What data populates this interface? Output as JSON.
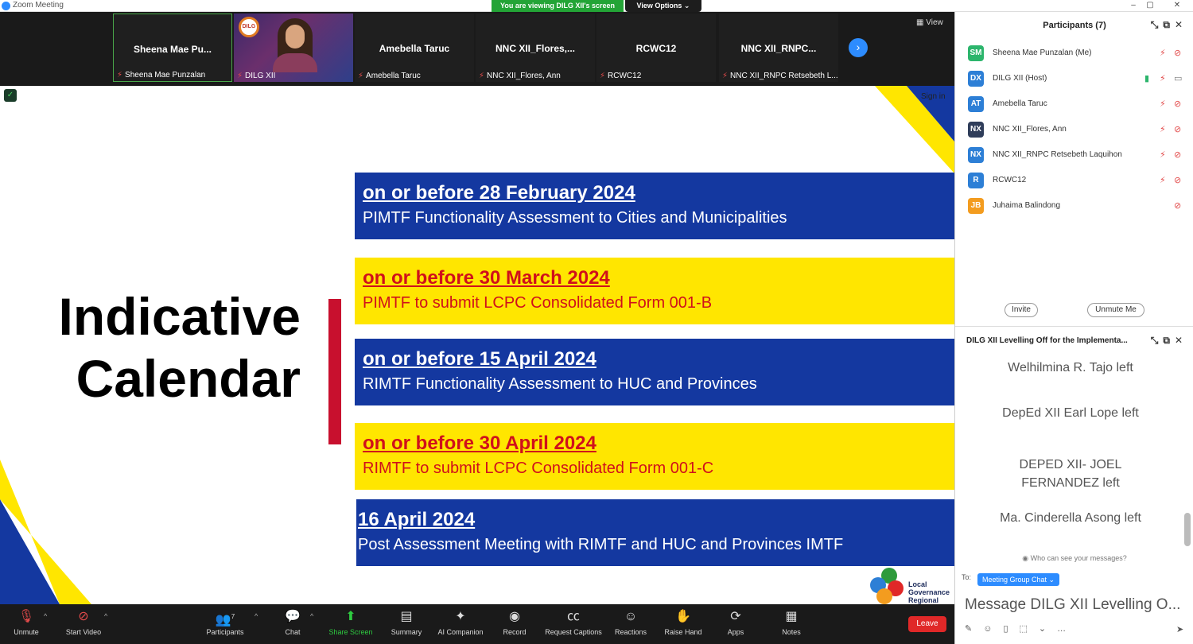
{
  "window": {
    "title": "Zoom Meeting",
    "share_banner": "You are viewing DILG XII's screen",
    "view_options": "View Options"
  },
  "strip": {
    "tiles": [
      {
        "name": "Sheena  Mae  Pu...",
        "label": "Sheena Mae Punzalan"
      },
      {
        "name": "",
        "label": "DILG XII"
      },
      {
        "name": "Amebella Taruc",
        "label": "Amebella Taruc"
      },
      {
        "name": "NNC XII_Flores,...",
        "label": "NNC XII_Flores, Ann"
      },
      {
        "name": "RCWC12",
        "label": "RCWC12"
      },
      {
        "name": "NNC XII_RNPC...",
        "label": "NNC XII_RNPC Retsebeth L..."
      }
    ],
    "view_label": "View",
    "logo_text": "DILG"
  },
  "slide": {
    "signin": "Sign in",
    "title_line1": "Indicative",
    "title_line2": "Calendar",
    "items": [
      {
        "date": "on or before 28 February 2024",
        "text": "PIMTF Functionality Assessment to Cities and Municipalities"
      },
      {
        "date": "on or before 30 March 2024",
        "text": "PIMTF to submit LCPC Consolidated Form 001-B"
      },
      {
        "date": "on or before 15 April 2024",
        "text": "RIMTF Functionality Assessment to HUC and Provinces"
      },
      {
        "date": "on or before 30 April 2024",
        "text": "RIMTF to submit LCPC Consolidated Form 001-C"
      },
      {
        "date": "16 April 2024",
        "text": "Post Assessment Meeting with RIMTF and HUC and Provinces  IMTF"
      }
    ],
    "logo_line1": "Local",
    "logo_line2": "Governance",
    "logo_line3": "Regional",
    "colors": {
      "blue": "#1438a0",
      "yellow": "#ffe600",
      "red": "#c8102e"
    }
  },
  "participants": {
    "title": "Participants (7)",
    "list": [
      {
        "initials": "SM",
        "name": "Sheena Mae Punzalan (Me)",
        "color": "#2cb56c"
      },
      {
        "initials": "DX",
        "name": "DILG XII (Host)",
        "color": "#2d7fd6"
      },
      {
        "initials": "AT",
        "name": "Amebella Taruc",
        "color": "#2d7fd6"
      },
      {
        "initials": "NX",
        "name": "NNC XII_Flores, Ann",
        "color": "#2f3d5a"
      },
      {
        "initials": "NX",
        "name": "NNC XII_RNPC Retsebeth Laquihon",
        "color": "#2d7fd6"
      },
      {
        "initials": "R",
        "name": "RCWC12",
        "color": "#2d7fd6"
      },
      {
        "initials": "JB",
        "name": "Juhaima Balindong",
        "color": "#f39c1f"
      }
    ],
    "invite": "Invite",
    "unmute_me": "Unmute Me"
  },
  "chat": {
    "title": "DILG XII Levelling Off for the Implementa...",
    "messages": [
      "Welhilmina R. Tajo left",
      "DepEd XII Earl Lope left",
      "DEPED XII- JOEL FERNANDEZ left",
      "Ma. Cinderella Asong left"
    ],
    "who_can_see": "Who can see your messages?",
    "to_label": "To:",
    "recipient": "Meeting Group Chat",
    "input_placeholder": "Message DILG XII Levelling O..."
  },
  "toolbar": {
    "unmute": "Unmute",
    "start_video": "Start Video",
    "participants": "Participants",
    "participant_count": "7",
    "chat": "Chat",
    "share_screen": "Share Screen",
    "summary": "Summary",
    "ai_companion": "AI Companion",
    "record": "Record",
    "request_captions": "Request Captions",
    "reactions": "Reactions",
    "raise_hand": "Raise Hand",
    "apps": "Apps",
    "notes": "Notes",
    "leave": "Leave"
  }
}
